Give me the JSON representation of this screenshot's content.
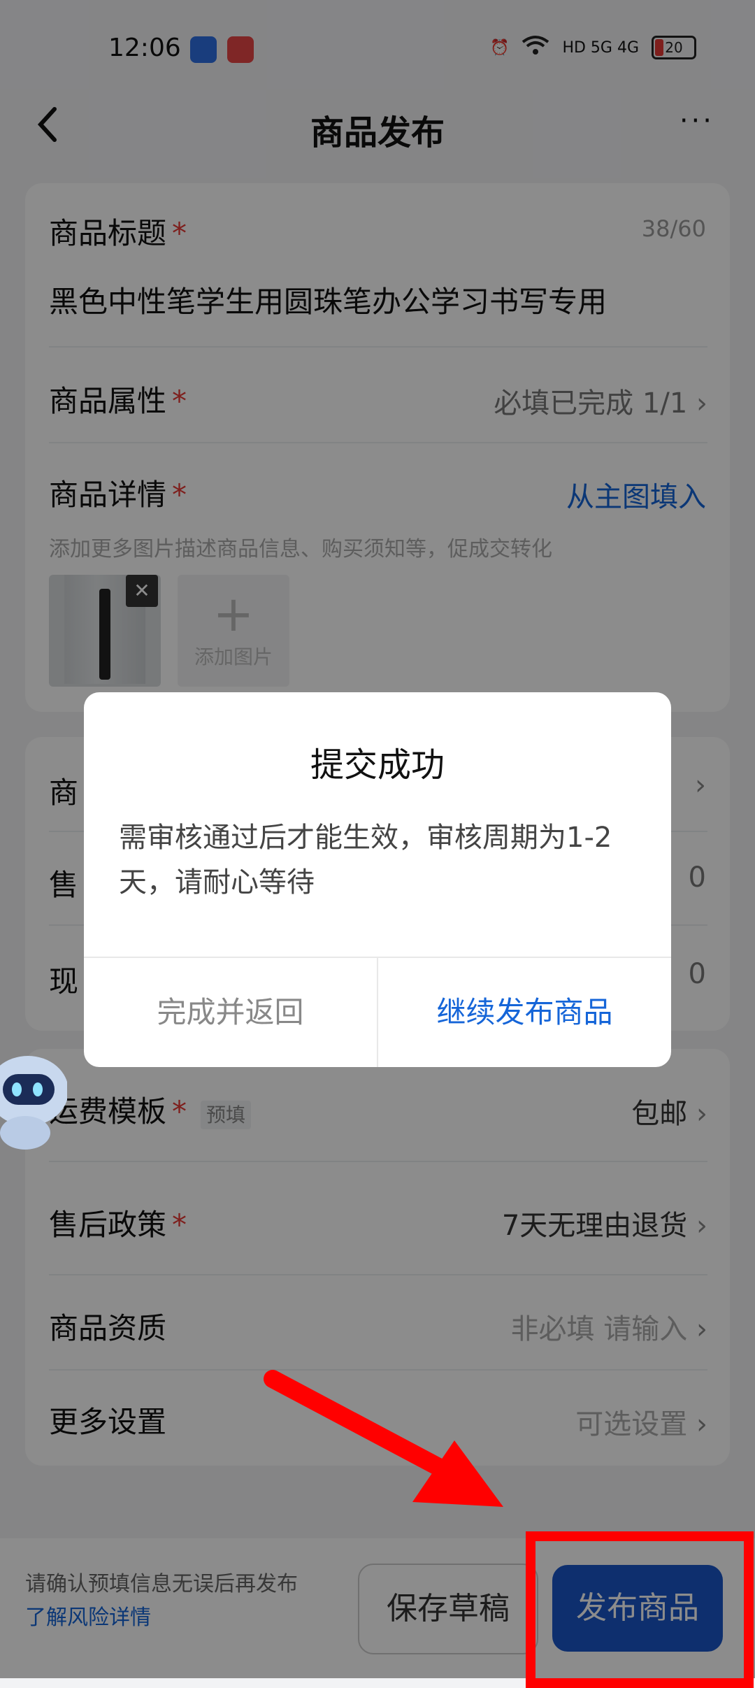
{
  "status_bar": {
    "time": "12:06",
    "network": "HD 5G 4G",
    "battery": "20"
  },
  "nav": {
    "title": "商品发布",
    "back_icon": "chevron-left-icon",
    "more": "···"
  },
  "form": {
    "title_label": "商品标题",
    "title_counter": "38/60",
    "title_value": "黑色中性笔学生用圆珠笔办公学习书写专用",
    "attr_label": "商品属性",
    "attr_value": "必填已完成 1/1",
    "detail_label": "商品详情",
    "detail_link": "从主图填入",
    "detail_hint": "添加更多图片描述商品信息、购买须知等，促成交转化",
    "add_image_label": "添加图片",
    "card2_rows": [
      {
        "label": "商",
        "value": ""
      },
      {
        "label": "售",
        "value": "0"
      },
      {
        "label": "现",
        "value": "0"
      }
    ],
    "shipping_label": "运费模板",
    "shipping_tag": "预填",
    "shipping_value": "包邮",
    "aftersale_label": "售后政策",
    "aftersale_value": "7天无理由退货",
    "qualification_label": "商品资质",
    "qualification_value": "非必填 请输入",
    "more_label": "更多设置",
    "more_value": "可选设置",
    "required_mark": "*",
    "chevron": "›"
  },
  "dialog": {
    "title": "提交成功",
    "body": "需审核通过后才能生效，审核周期为1-2天，请耐心等待",
    "btn_done": "完成并返回",
    "btn_continue": "继续发布商品"
  },
  "bottom": {
    "risk_text": "请确认预填信息无误后再发布",
    "risk_link": "了解风险详情",
    "draft_label": "保存草稿",
    "publish_label": "发布商品"
  },
  "colors": {
    "accent": "#1a56c8",
    "link": "#1565d8",
    "required": "#e53935",
    "annotation": "#ff0000"
  }
}
